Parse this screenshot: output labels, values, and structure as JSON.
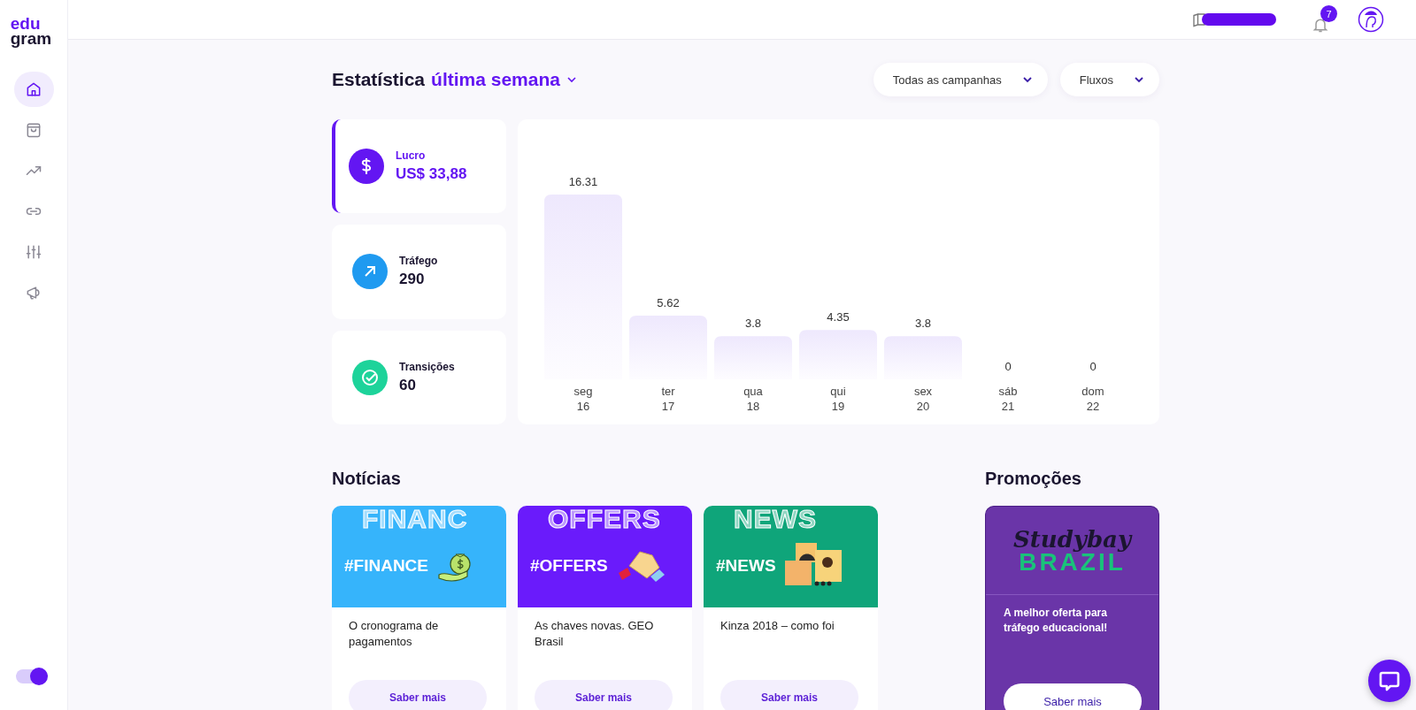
{
  "sidebar": {
    "logo": [
      "edu",
      "gram"
    ],
    "nav_items": [
      {
        "kind": "home",
        "selected": true
      },
      {
        "kind": "bag",
        "selected": false
      },
      {
        "kind": "trend",
        "selected": false
      },
      {
        "kind": "link",
        "selected": false
      },
      {
        "kind": "sliders",
        "selected": false
      },
      {
        "kind": "megaphone",
        "selected": false
      }
    ],
    "theme_toggle": {
      "on": true
    }
  },
  "top_bar": {
    "notifications_badge": "7"
  },
  "statistics": {
    "title": "Estatística",
    "period": "última semana",
    "filters": [
      {
        "label": "Todas as campanhas"
      },
      {
        "label": "Fluxos"
      }
    ],
    "metrics": [
      {
        "kind": "dollar",
        "label": "Lucro",
        "value": "US$ 33,88",
        "color": "#6316f2",
        "selected": true
      },
      {
        "kind": "arrow",
        "label": "Tráfego",
        "value": "290",
        "color": "#1f9af0",
        "selected": false
      },
      {
        "kind": "check",
        "label": "Transições",
        "value": "60",
        "color": "#1dd39a",
        "selected": false
      }
    ],
    "chart_data": {
      "type": "bar",
      "categories": [
        "seg\n16",
        "ter\n17",
        "qua\n18",
        "qui\n19",
        "sex\n20",
        "sáb\n21",
        "dom\n22"
      ],
      "values": [
        16.31,
        5.62,
        3.8,
        4.35,
        3.8,
        0,
        0
      ],
      "value_labels": [
        "16.31",
        "5.62",
        "3.8",
        "4.35",
        "3.8",
        "0",
        "0"
      ]
    }
  },
  "news": {
    "title": "Notícias",
    "cards": [
      {
        "kind": "finance",
        "color": "#36b4fb",
        "banner_word": "FINANC",
        "tag": "#FINANCE",
        "text": "O cronograma de pagamentos",
        "button": "Saber mais"
      },
      {
        "kind": "offers",
        "color": "#6a1bfb",
        "banner_word": "OFFERS",
        "tag": "#OFFERS",
        "text": "As chaves novas. GEO Brasil",
        "button": "Saber mais"
      },
      {
        "kind": "news",
        "color": "#0fa57a",
        "banner_word": "NEWS",
        "tag": "#NEWS",
        "text": "Kinza 2018 – como foi",
        "button": "Saber mais"
      }
    ]
  },
  "promotions": {
    "title": "Promoções",
    "card": {
      "logo_script": "Studybay",
      "logo_word": "BRAZIL",
      "text": "A melhor oferta para tráfego educacional!",
      "button": "Saber mais"
    }
  }
}
